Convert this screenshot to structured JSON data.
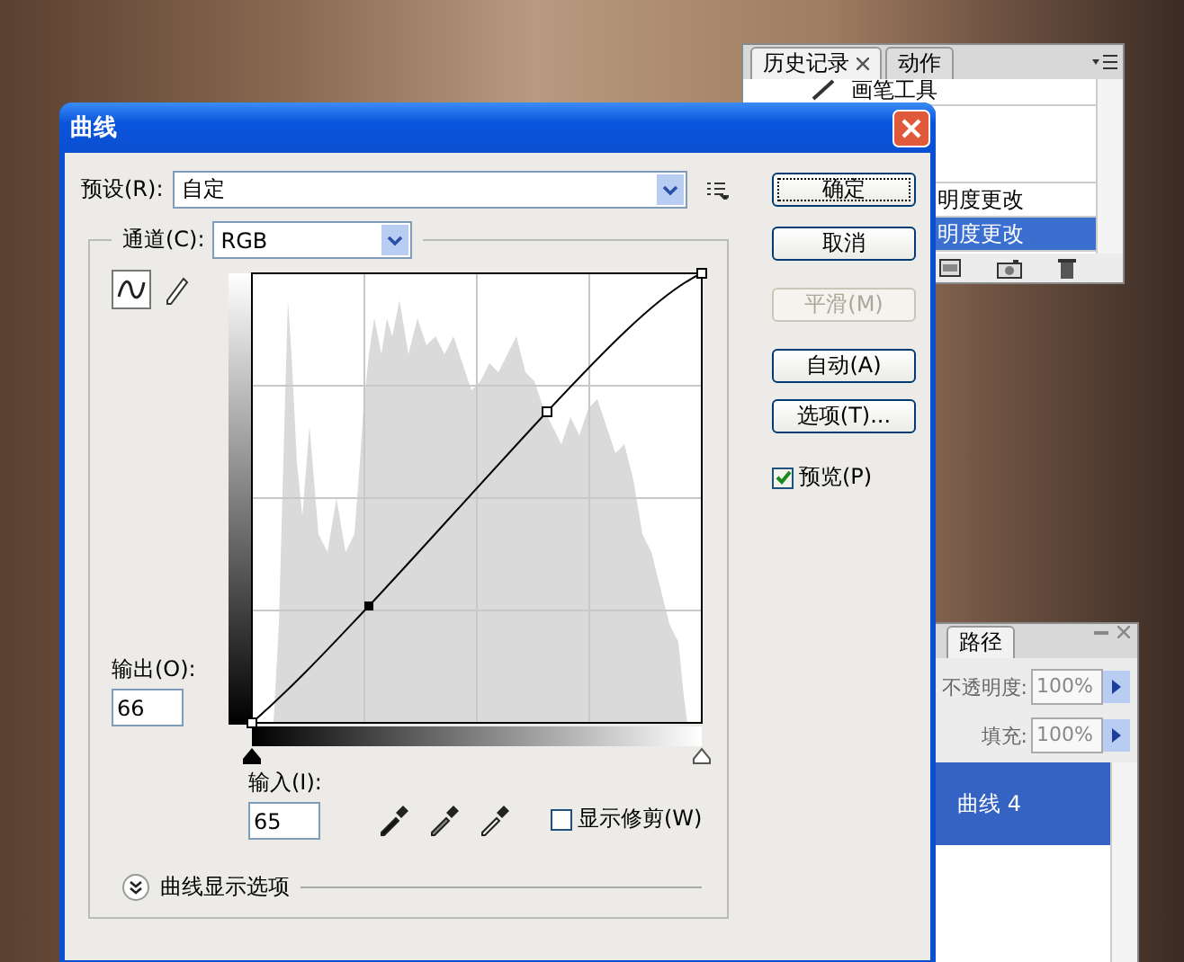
{
  "history_panel": {
    "tabs": [
      {
        "label": "历史记录",
        "selected": true
      },
      {
        "label": "动作",
        "selected": false
      }
    ],
    "items": [
      {
        "label": "画笔工具",
        "selected": false
      },
      {
        "label": "明度更改",
        "selected": false
      },
      {
        "label": "明度更改",
        "selected": true
      }
    ]
  },
  "layers_panel": {
    "tab": "路径",
    "opacity_label": "不透明度:",
    "opacity": "100%",
    "fill_label": "填充:",
    "fill": "100%",
    "layers": [
      {
        "label": "曲线 4",
        "selected": true
      }
    ]
  },
  "dialog": {
    "title": "曲线",
    "preset_label": "预设(R):",
    "preset_value": "自定",
    "channel_label": "通道(C):",
    "channel_value": "RGB",
    "output_label": "输出(O):",
    "output_value": "66",
    "input_label": "输入(I):",
    "input_value": "65",
    "show_clipping": {
      "label": "显示修剪(W)",
      "checked": false
    },
    "display_options": "曲线显示选项",
    "buttons": [
      {
        "label": "确定",
        "focused": true,
        "disabled": false
      },
      {
        "label": "取消",
        "focused": false,
        "disabled": false
      },
      {
        "label": "平滑(M)",
        "focused": false,
        "disabled": true
      },
      {
        "label": "自动(A)",
        "focused": false,
        "disabled": false
      },
      {
        "label": "选项(T)...",
        "focused": false,
        "disabled": false
      }
    ],
    "preview": {
      "label": "预览(P)",
      "checked": true
    }
  }
}
